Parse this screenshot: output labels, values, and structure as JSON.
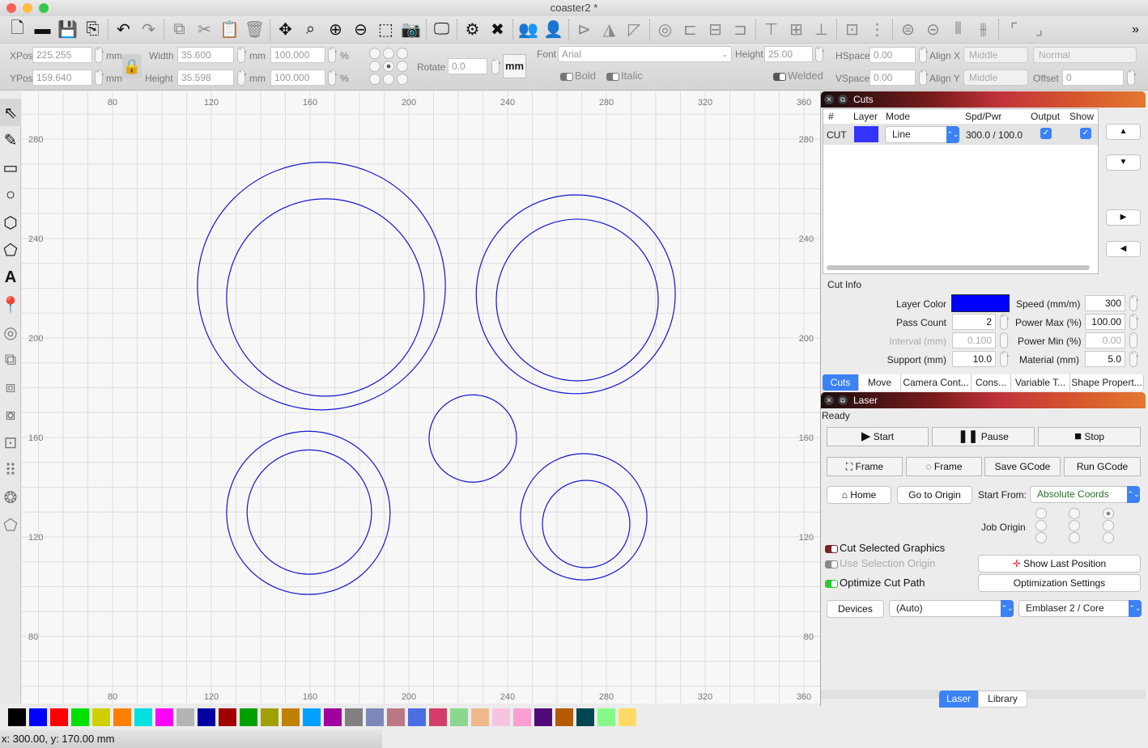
{
  "window": {
    "title": "coaster2 *"
  },
  "toolbar_main": {
    "icons": [
      "new-file",
      "open-folder",
      "save",
      "import",
      "undo",
      "redo",
      "copy",
      "cut",
      "paste",
      "delete",
      "move",
      "zoom-selection",
      "zoom-in",
      "zoom-out",
      "frame-selection",
      "camera",
      "monitor",
      "settings",
      "tools",
      "group",
      "ungroup",
      "flip-horizontal",
      "mirror",
      "mirror-diagonal",
      "target",
      "align-left",
      "align-center-h",
      "align-right",
      "align-top",
      "align-middle-v",
      "align-bottom",
      "distribute-h",
      "distribute-v",
      "make-same-width",
      "make-same-height",
      "dock-left",
      "dock-right",
      "corner-top-left",
      "corner-bottom-right"
    ],
    "overflow_label": "»"
  },
  "toolbar_props": {
    "xpos_label": "XPos",
    "xpos_value": "225.255",
    "ypos_label": "YPos",
    "ypos_value": "159.640",
    "unit_mm": "mm",
    "width_label": "Width",
    "width_value": "35.600",
    "height_label": "Height",
    "height_value": "35.598",
    "scale_w_value": "100.000",
    "scale_h_value": "100.000",
    "percent": "%",
    "rotate_label": "Rotate",
    "rotate_value": "0.0",
    "units_button": "mm",
    "font_label": "Font",
    "font_value": "Arial",
    "text_height_label": "Height",
    "text_height_value": "25.00",
    "hspace_label": "HSpace",
    "hspace_value": "0.00",
    "vspace_label": "VSpace",
    "vspace_value": "0.00",
    "alignx_label": "Align X",
    "alignx_value": "Middle",
    "aligny_label": "Align Y",
    "aligny_value": "Middle",
    "style_value": "Normal",
    "offset_label": "Offset",
    "offset_value": "0",
    "bold_label": "Bold",
    "italic_label": "Italic",
    "welded_label": "Welded"
  },
  "left_tools": [
    "select",
    "draw-lines",
    "rectangle",
    "ellipse",
    "polygon",
    "polyline",
    "text",
    "position-laser",
    "offset",
    "boolean-union",
    "boolean-difference",
    "boolean-intersection",
    "weld",
    "grid-array",
    "circular-array",
    "edit-nodes"
  ],
  "ruler": {
    "x_ticks": [
      "80",
      "120",
      "160",
      "200",
      "240",
      "280",
      "320",
      "360"
    ],
    "y_ticks": [
      "280",
      "240",
      "200",
      "160",
      "120",
      "80"
    ]
  },
  "canvas": {
    "shape_color": "#1515d0",
    "circles_mm": [
      {
        "cx": 164.6,
        "cy": 220.9,
        "r": 50.2
      },
      {
        "cx": 166.2,
        "cy": 216.3,
        "r": 40.0
      },
      {
        "cx": 267.6,
        "cy": 217.6,
        "r": 40.3
      },
      {
        "cx": 268.2,
        "cy": 215.3,
        "r": 32.8
      },
      {
        "cx": 225.9,
        "cy": 159.6,
        "r": 17.7
      },
      {
        "cx": 159.3,
        "cy": 129.7,
        "r": 33.1
      },
      {
        "cx": 159.7,
        "cy": 130.0,
        "r": 25.2
      },
      {
        "cx": 270.8,
        "cy": 128.1,
        "r": 25.6
      },
      {
        "cx": 271.8,
        "cy": 125.2,
        "r": 17.7
      }
    ]
  },
  "palette": [
    "#000000",
    "#0000ff",
    "#ff0000",
    "#00e000",
    "#d0d000",
    "#ff8000",
    "#00e0e0",
    "#ff00ff",
    "#b4b4b4",
    "#0000a0",
    "#a00000",
    "#00a000",
    "#a0a000",
    "#c08000",
    "#00a0ff",
    "#a000a0",
    "#808080",
    "#7d87b9",
    "#bb7784",
    "#4a6fe3",
    "#d33f6a",
    "#8cd78f",
    "#f0b98d",
    "#f6c4e1",
    "#fa9ed4",
    "#500a78",
    "#b45a00",
    "#004754",
    "#86fa88",
    "#ffdb66"
  ],
  "status": {
    "coords": "x: 300.00, y: 170.00 mm"
  },
  "cuts_panel": {
    "title": "Cuts",
    "columns": [
      "#",
      "Layer",
      "Mode",
      "Spd/Pwr",
      "Output",
      "Show"
    ],
    "rows": [
      {
        "id": "CUT",
        "layer_color": "#3333ff",
        "mode": "Line",
        "spd_pwr": "300.0 / 100.0",
        "output": true,
        "show": true
      }
    ],
    "side_buttons": [
      "move-up",
      "move-down",
      "move-right",
      "move-left"
    ],
    "cut_info_label": "Cut Info",
    "layer_color_label": "Layer Color",
    "layer_color": "#0000ff",
    "speed_label": "Speed (mm/m)",
    "speed_value": "300",
    "pass_count_label": "Pass Count",
    "pass_count_value": "2",
    "power_max_label": "Power Max (%)",
    "power_max_value": "100.00",
    "interval_label": "Interval (mm)",
    "interval_value": "0.100",
    "power_min_label": "Power Min (%)",
    "power_min_value": "0.00",
    "support_label": "Support (mm)",
    "support_value": "10.0",
    "material_label": "Material (mm)",
    "material_value": "5.0",
    "tabs": [
      "Cuts",
      "Move",
      "Camera Cont...",
      "Cons...",
      "Variable T...",
      "Shape Propert..."
    ],
    "active_tab": "Cuts"
  },
  "laser_panel": {
    "title": "Laser",
    "status": "Ready",
    "start": "Start",
    "pause": "Pause",
    "stop": "Stop",
    "frame1": "Frame",
    "frame2": "Frame",
    "save_gcode": "Save GCode",
    "run_gcode": "Run GCode",
    "home": "Home",
    "go_to_origin": "Go to Origin",
    "start_from_label": "Start From:",
    "start_from_value": "Absolute Coords",
    "job_origin_label": "Job Origin",
    "job_origin_selected": "top-right",
    "cut_selected_label": "Cut Selected Graphics",
    "cut_selected": false,
    "use_selection_origin_label": "Use Selection Origin",
    "use_selection_origin": false,
    "optimize_label": "Optimize Cut Path",
    "optimize": true,
    "show_last_position": "Show Last Position",
    "optimization_settings": "Optimization Settings",
    "devices": "Devices",
    "port_value": "(Auto)",
    "device_value": "Emblaser 2 / Core"
  },
  "bottom_tabs": [
    "Laser",
    "Library"
  ],
  "bottom_active": "Laser"
}
